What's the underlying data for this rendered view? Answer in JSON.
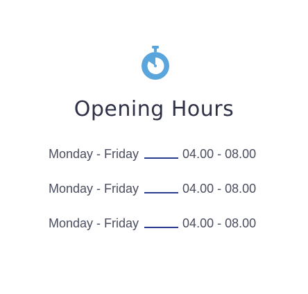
{
  "section": {
    "title": "Opening Hours",
    "icon": "stopwatch-icon",
    "accent_color": "#5aa6dc",
    "dash_color": "#2a3a8c"
  },
  "hours": [
    {
      "days": "Monday - Friday",
      "time": "04.00 - 08.00"
    },
    {
      "days": "Monday - Friday",
      "time": "04.00 - 08.00"
    },
    {
      "days": "Monday - Friday",
      "time": "04.00 - 08.00"
    }
  ]
}
